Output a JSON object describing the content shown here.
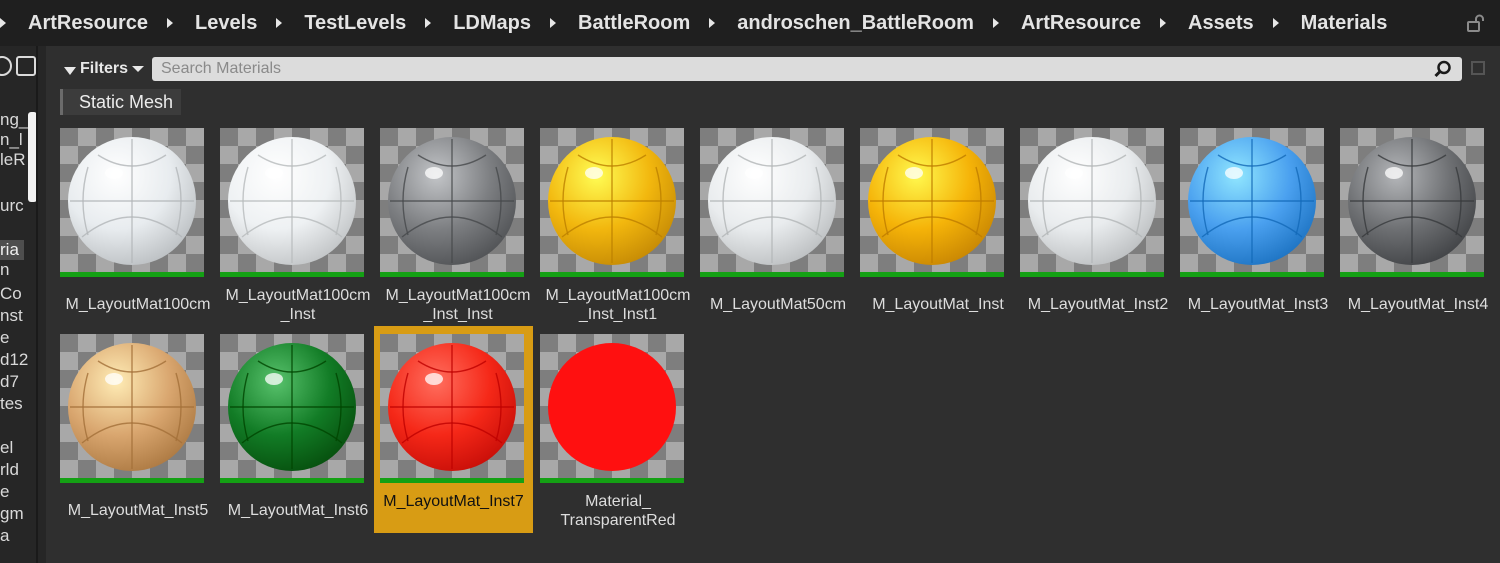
{
  "breadcrumb": [
    "ArtResource",
    "Levels",
    "TestLevels",
    "LDMaps",
    "BattleRoom",
    "androschen_BattleRoom",
    "ArtResource",
    "Assets",
    "Materials"
  ],
  "left_panel": {
    "items": [
      "ng_",
      "n_l",
      "leR",
      "urc",
      "ria",
      "n",
      "Co",
      "nst",
      "e",
      "d12",
      "d7",
      "tes",
      "el",
      "rld",
      "e",
      "gm",
      "a"
    ]
  },
  "toolbar": {
    "filters_label": "Filters",
    "search_placeholder": "Search Materials"
  },
  "filter_chip": "Static Mesh",
  "assets": [
    {
      "label": "M_LayoutMat100cm",
      "color": "#e8ecef",
      "selected": false
    },
    {
      "label": "M_LayoutMat100cm\n_Inst",
      "color": "#eef1f3",
      "selected": false
    },
    {
      "label": "M_LayoutMat100cm\n_Inst_Inst",
      "color": "#7d7f82",
      "selected": false
    },
    {
      "label": "M_LayoutMat100cm\n_Inst_Inst1",
      "color": "#f2b70e",
      "selected": false
    },
    {
      "label": "M_LayoutMat50cm",
      "color": "#e9ecee",
      "selected": false
    },
    {
      "label": "M_LayoutMat_Inst",
      "color": "#f5b308",
      "selected": false
    },
    {
      "label": "M_LayoutMat_Inst2",
      "color": "#e9ecee",
      "selected": false
    },
    {
      "label": "M_LayoutMat_Inst3",
      "color": "#4aa0ef",
      "selected": false
    },
    {
      "label": "M_LayoutMat_Inst4",
      "color": "#6e7073",
      "selected": false
    },
    {
      "label": "M_LayoutMat_Inst5",
      "color": "#d9a66f",
      "selected": false
    },
    {
      "label": "M_LayoutMat_Inst6",
      "color": "#127c26",
      "selected": false
    },
    {
      "label": "M_LayoutMat_Inst7",
      "color": "#f52818",
      "selected": true
    },
    {
      "label": "Material_\nTransparentRed",
      "color": "#ff1010",
      "selected": false
    }
  ],
  "colors": {
    "selection": "#d89c14",
    "thumb_underline": "#14a014"
  }
}
